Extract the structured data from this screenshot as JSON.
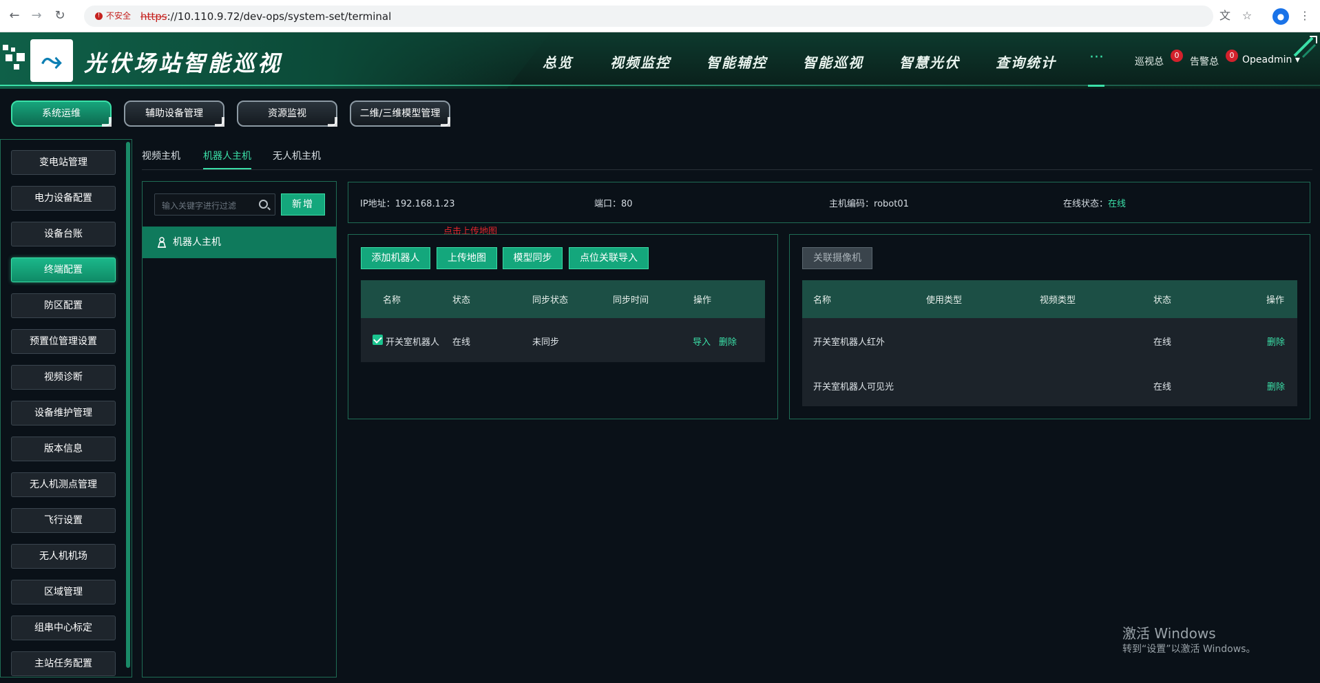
{
  "browser": {
    "not_secure": "不安全",
    "url_protocol": "https",
    "url_rest": "://10.110.9.72/dev-ops/system-set/terminal"
  },
  "header": {
    "title": "光伏场站智能巡视",
    "nav": [
      "总览",
      "视频监控",
      "智能辅控",
      "智能巡视",
      "智慧光伏",
      "查询统计"
    ],
    "more": "···",
    "patrol_label": "巡视总",
    "patrol_count": "0",
    "alarm_label": "告警总",
    "alarm_count": "0",
    "user": "Opeadmin"
  },
  "module_tabs": [
    "系统运维",
    "辅助设备管理",
    "资源监视",
    "二维/三维模型管理"
  ],
  "sidebar": {
    "items": [
      "变电站管理",
      "电力设备配置",
      "设备台账",
      "终端配置",
      "防区配置",
      "预置位管理设置",
      "视频诊断",
      "设备维护管理",
      "版本信息",
      "无人机测点管理",
      "飞行设置",
      "无人机机场",
      "区域管理",
      "组串中心标定",
      "主站任务配置"
    ],
    "active_index": 3
  },
  "sub_tabs": [
    "视频主机",
    "机器人主机",
    "无人机主机"
  ],
  "host_list": {
    "search_placeholder": "输入关键字进行过滤",
    "new_button": "新增",
    "items": [
      "机器人主机"
    ]
  },
  "info": {
    "ip_label": "IP地址：",
    "ip": "192.168.1.23",
    "port_label": "端口：",
    "port": "80",
    "code_label": "主机编码：",
    "code": "robot01",
    "status_label": "在线状态：",
    "status": "在线"
  },
  "robot_panel": {
    "hint": "点击上传地图",
    "buttons": [
      "添加机器人",
      "上传地图",
      "模型同步",
      "点位关联导入"
    ],
    "columns": [
      "名称",
      "状态",
      "同步状态",
      "同步时间",
      "操作"
    ],
    "rows": [
      {
        "name": "开关室机器人",
        "status": "在线",
        "sync_status": "未同步",
        "sync_time": "",
        "action_import": "导入",
        "action_delete": "删除"
      }
    ]
  },
  "camera_panel": {
    "button": "关联摄像机",
    "columns": [
      "名称",
      "使用类型",
      "视频类型",
      "状态",
      "操作"
    ],
    "rows": [
      {
        "name": "开关室机器人红外",
        "use_type": "",
        "video_type": "",
        "status": "在线",
        "action": "删除"
      },
      {
        "name": "开关室机器人可见光",
        "use_type": "",
        "video_type": "",
        "status": "在线",
        "action": "删除"
      }
    ]
  },
  "watermark": {
    "line1": "激活 Windows",
    "line2": "转到“设置”以激活 Windows。"
  },
  "colors": {
    "accent": "#3be0a8",
    "button_green": "#14a77c",
    "danger": "#e2262c",
    "background": "#0a1118"
  }
}
